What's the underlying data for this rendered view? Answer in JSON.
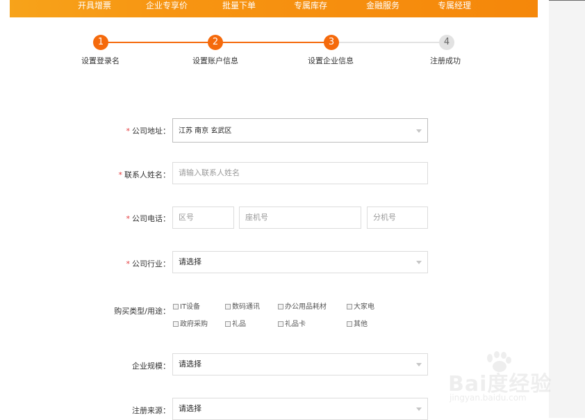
{
  "nav": [
    "开具增票",
    "企业专享价",
    "批量下单",
    "专属库存",
    "金融服务",
    "专属经理"
  ],
  "steps": [
    {
      "num": "1",
      "label": "设置登录名"
    },
    {
      "num": "2",
      "label": "设置账户信息"
    },
    {
      "num": "3",
      "label": "设置企业信息"
    },
    {
      "num": "4",
      "label": "注册成功"
    }
  ],
  "colors": {
    "accent": "#f5870a",
    "step_active": "#f56a0c",
    "step_inactive": "#e2e2e2",
    "required": "#e4393c"
  },
  "form": {
    "address": {
      "label": "公司地址：",
      "value": "江苏 南京 玄武区"
    },
    "contact": {
      "label": "联系人姓名：",
      "placeholder": "请输入联系人姓名"
    },
    "phone": {
      "label": "公司电话：",
      "area": "区号",
      "landline": "座机号",
      "ext": "分机号"
    },
    "industry": {
      "label": "公司行业：",
      "value": "请选择"
    },
    "purchase": {
      "label": "购买类型/用途：",
      "options": [
        "IT设备",
        "数码通讯",
        "办公用品耗材",
        "大家电",
        "政府采购",
        "礼品",
        "礼品卡",
        "其他"
      ]
    },
    "scale": {
      "label": "企业规模：",
      "value": "请选择"
    },
    "source": {
      "label": "注册来源：",
      "value": "请选择"
    }
  },
  "watermark": {
    "brand": "Bai度经验",
    "url": "jingyan.baidu.com"
  }
}
